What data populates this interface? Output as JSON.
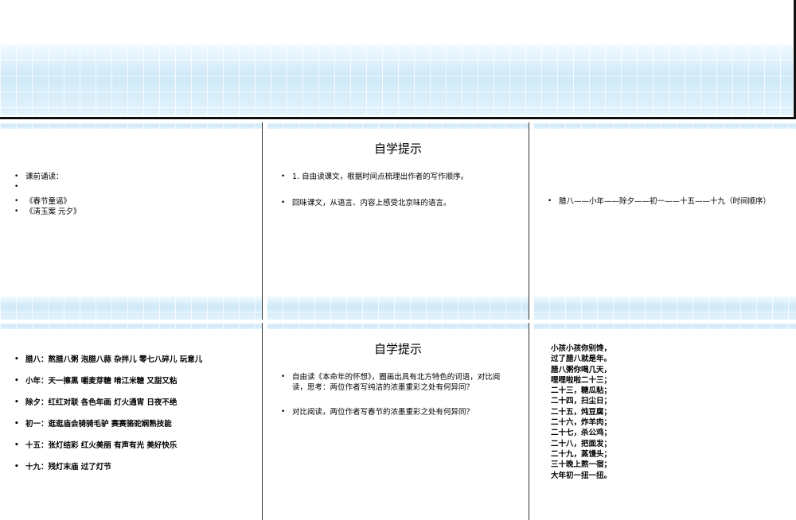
{
  "slide1": {
    "bullets": [
      "课前诵读：",
      "",
      "《春节童谣》",
      "《清玉案 元夕》"
    ]
  },
  "slide2": {
    "title": "自学提示",
    "bullets": [
      "1. 自由读课文，根据时间点梳理出作者的写作顺序。",
      "回味课文，从语言、内容上感受北京味的语言。"
    ]
  },
  "slide3": {
    "bullets": [
      "腊八——小年——除夕——初一——十五——十九（时间顺序）"
    ]
  },
  "slide4": {
    "bullets": [
      "腊八：熬腊八粥  泡腊八蒜  杂拌儿   零七八碎儿  玩意儿",
      "小年：天一擦黑  嚼麦芽糖  啃江米糖  又甜又粘",
      "除夕：红红对联  各色年画  灯火通宵  日夜不绝",
      "初一：逛逛庙会骑骑毛驴   赛赛骆驼娴熟技能",
      "十五：张灯结彩  红火美丽  有声有光  美好快乐",
      "十九：残灯末庙  过了灯节"
    ]
  },
  "slide5": {
    "title": "自学提示",
    "bullets": [
      "自由读《本命年的怀想》，圈画出具有北方特色的词语，对比阅读，思考：两位作者写纯洁的浓墨重彩之处有何异同？",
      "对比阅读，两位作者写春节的浓墨重彩之处有何异同？"
    ]
  },
  "slide6": {
    "lines": [
      "小孩小孩你别馋，",
      "过了腊八就是年。",
      "腊八粥你喝几天，",
      "哩哩啦啦二十三；",
      "二十三，糖瓜粘；",
      "二十四，扫尘日；",
      "二十五，炖豆腐；",
      "二十六，炸羊肉；",
      "二十七，杀公鸡；",
      "二十八，把面发；",
      "二十九，蒸馒头；",
      "三十晚上熬一宿；",
      "大年初一扭一扭。"
    ]
  }
}
